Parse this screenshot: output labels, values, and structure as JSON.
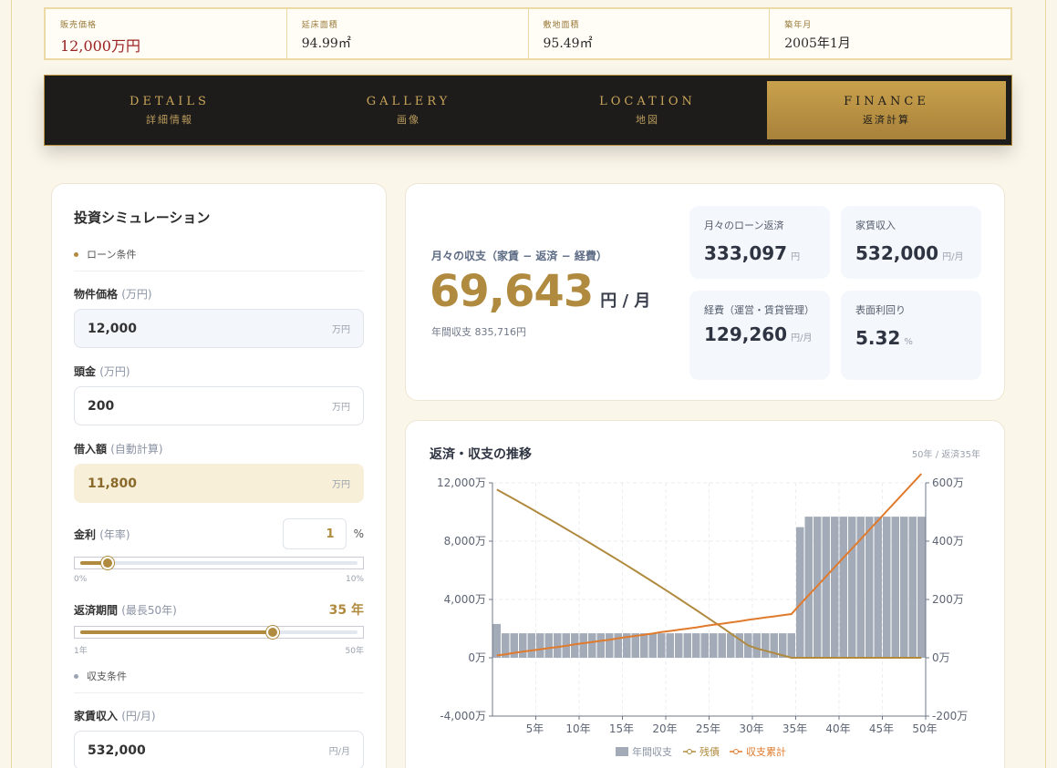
{
  "summary": [
    {
      "label": "販売価格",
      "value": "12,000万円"
    },
    {
      "label": "延床面積",
      "value": "94.99㎡"
    },
    {
      "label": "敷地面積",
      "value": "95.49㎡"
    },
    {
      "label": "築年月",
      "value": "2005年1月"
    }
  ],
  "tabs": [
    {
      "en": "DETAILS",
      "ja": "詳細情報"
    },
    {
      "en": "GALLERY",
      "ja": "画像"
    },
    {
      "en": "LOCATION",
      "ja": "地図"
    },
    {
      "en": "FINANCE",
      "ja": "返済計算"
    }
  ],
  "active_tab": "FINANCE",
  "sim": {
    "title": "投資シミュレーション",
    "loan_section": "ローン条件",
    "income_section": "収支条件",
    "price": {
      "label": "物件価格",
      "sub": "(万円)",
      "value": "12,000",
      "unit": "万円"
    },
    "down": {
      "label": "頭金",
      "sub": "(万円)",
      "value": "200",
      "unit": "万円"
    },
    "borrow": {
      "label": "借入額",
      "sub": "(自動計算)",
      "value": "11,800",
      "unit": "万円"
    },
    "rate": {
      "label": "金利",
      "sub": "(年率)",
      "value": "1",
      "unit": "%",
      "min": "0%",
      "max": "10%",
      "fraction": 0.1
    },
    "term": {
      "label": "返済期間",
      "sub": "(最長50年)",
      "value": "35 年",
      "min": "1年",
      "max": "50年",
      "fraction": 0.694
    },
    "rent": {
      "label": "家賃収入",
      "sub": "(円/月)",
      "value": "532,000",
      "unit": "円/月"
    }
  },
  "monthly": {
    "label": "月々の収支（家賃 − 返済 − 経費）",
    "value": "69,643",
    "unit": "円 / 月",
    "yearly": "年間収支 835,716円"
  },
  "stats": [
    {
      "title": "月々のローン返済",
      "value": "333,097",
      "unit": "円"
    },
    {
      "title": "家賃収入",
      "value": "532,000",
      "unit": "円/月"
    },
    {
      "title": "経費（運営・賃貸管理）",
      "value": "129,260",
      "unit": "円/月"
    },
    {
      "title": "表面利回り",
      "value": "5.32",
      "unit": "%"
    }
  ],
  "chart_title": "返済・収支の推移",
  "chart_sub": "50年 / 返済35年",
  "chart_data": {
    "type": "bar",
    "x": [
      1,
      2,
      3,
      4,
      5,
      6,
      7,
      8,
      9,
      10,
      11,
      12,
      13,
      14,
      15,
      16,
      17,
      18,
      19,
      20,
      21,
      22,
      23,
      24,
      25,
      26,
      27,
      28,
      29,
      30,
      31,
      32,
      33,
      34,
      35,
      36,
      37,
      38,
      39,
      40,
      41,
      42,
      43,
      44,
      45,
      46,
      47,
      48,
      49,
      50
    ],
    "x_ticks": [
      "5年",
      "10年",
      "15年",
      "20年",
      "25年",
      "30年",
      "35年",
      "40年",
      "45年",
      "50年"
    ],
    "y_left_ticks": [
      "12,000万",
      "8,000万",
      "4,000万",
      "0万",
      "-4,000万"
    ],
    "y_right_ticks": [
      "600万",
      "400万",
      "200万",
      "0万",
      "-200万"
    ],
    "ylim_left": [
      -4000,
      12000
    ],
    "ylim_right": [
      -200,
      600
    ],
    "series": [
      {
        "name": "年間収支",
        "axis": "right",
        "kind": "bar",
        "color": "#a3abb9",
        "values": [
          116,
          84,
          84,
          84,
          84,
          84,
          84,
          84,
          84,
          84,
          84,
          84,
          84,
          84,
          84,
          84,
          84,
          84,
          84,
          84,
          84,
          84,
          84,
          84,
          84,
          84,
          84,
          84,
          84,
          84,
          84,
          84,
          84,
          84,
          84,
          448,
          484,
          484,
          484,
          484,
          484,
          484,
          484,
          484,
          484,
          484,
          484,
          484,
          484,
          484
        ]
      },
      {
        "name": "残債",
        "axis": "left",
        "kind": "line",
        "color": "#b08a3e",
        "values": [
          11540,
          11210,
          10880,
          10550,
          10210,
          9870,
          9530,
          9190,
          8840,
          8490,
          8140,
          7780,
          7420,
          7060,
          6700,
          6330,
          5960,
          5590,
          5210,
          4830,
          4450,
          4060,
          3670,
          3280,
          2880,
          2480,
          2080,
          1670,
          1260,
          850,
          640,
          480,
          320,
          160,
          0,
          0,
          0,
          0,
          0,
          0,
          0,
          0,
          0,
          0,
          0,
          0,
          0,
          0,
          0,
          0
        ]
      },
      {
        "name": "収支累計",
        "axis": "right",
        "kind": "line",
        "color": "#e07a2c",
        "values": [
          8,
          12,
          17,
          21,
          25,
          29,
          33,
          37,
          41,
          46,
          50,
          54,
          58,
          62,
          67,
          71,
          75,
          79,
          83,
          88,
          92,
          96,
          100,
          104,
          109,
          113,
          117,
          121,
          125,
          130,
          134,
          138,
          142,
          146,
          150,
          183,
          215,
          247,
          279,
          311,
          343,
          375,
          407,
          439,
          471,
          503,
          535,
          567,
          599,
          631
        ]
      }
    ],
    "legend": [
      "年間収支",
      "残債",
      "収支累計"
    ]
  }
}
